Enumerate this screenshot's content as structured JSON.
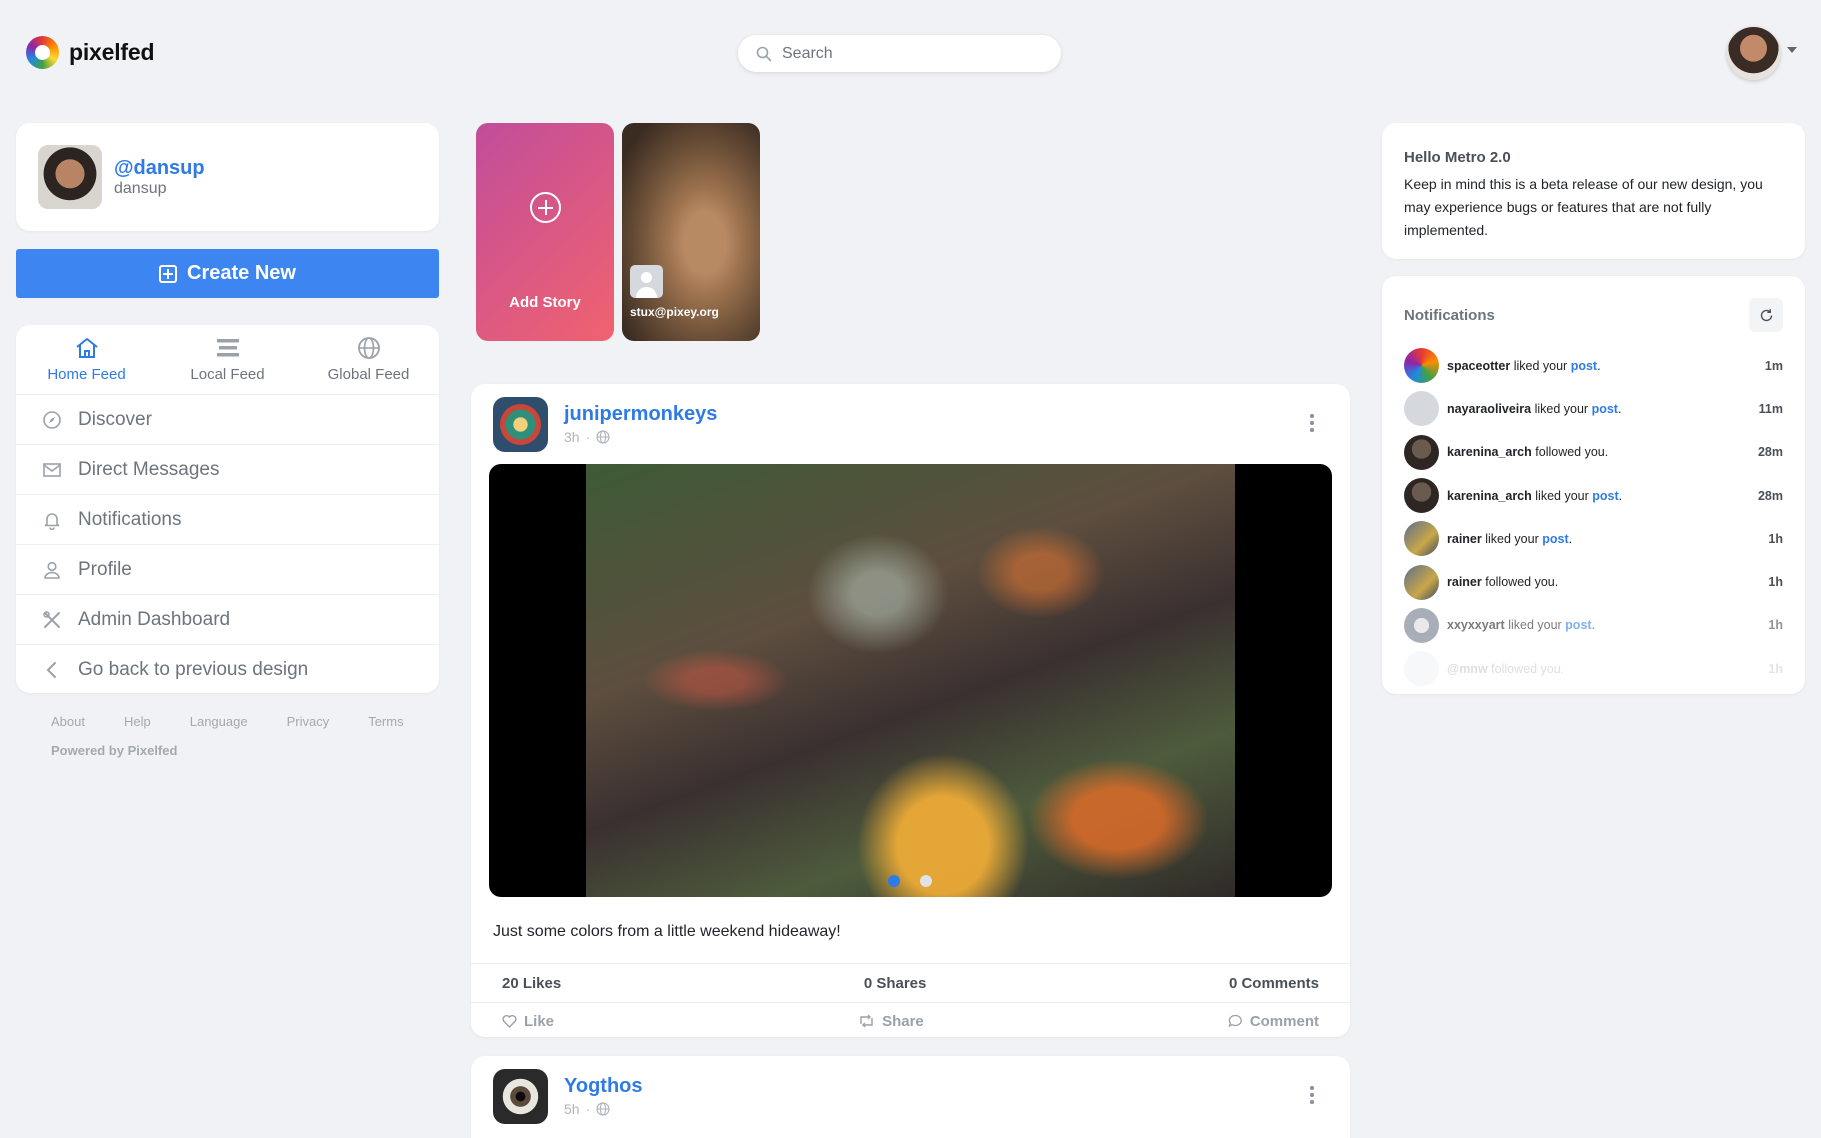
{
  "header": {
    "logo_text": "pixelfed",
    "search_placeholder": "Search"
  },
  "profile": {
    "handle": "@dansup",
    "name": "dansup"
  },
  "create_button": "Create New",
  "feed_tabs": [
    {
      "label": "Home Feed",
      "active": true,
      "icon": "home-icon"
    },
    {
      "label": "Local Feed",
      "active": false,
      "icon": "stack-icon"
    },
    {
      "label": "Global Feed",
      "active": false,
      "icon": "globe-icon"
    }
  ],
  "nav": [
    {
      "label": "Discover",
      "icon": "compass-icon"
    },
    {
      "label": "Direct Messages",
      "icon": "envelope-icon"
    },
    {
      "label": "Notifications",
      "icon": "bell-icon"
    },
    {
      "label": "Profile",
      "icon": "user-icon"
    },
    {
      "label": "Admin Dashboard",
      "icon": "tools-icon"
    },
    {
      "label": "Go back to previous design",
      "icon": "chevron-left-icon"
    }
  ],
  "footer": {
    "links": [
      "About",
      "Help",
      "Language",
      "Privacy",
      "Terms"
    ],
    "powered": "Powered by Pixelfed"
  },
  "stories": {
    "add_label": "Add Story",
    "items": [
      {
        "user": "stux@pixey.org"
      }
    ]
  },
  "posts": [
    {
      "username": "junipermonkeys",
      "time": "3h",
      "caption": "Just some colors from a little weekend hideaway!",
      "likes": "20 Likes",
      "shares": "0 Shares",
      "comments": "0 Comments",
      "actions": {
        "like": "Like",
        "share": "Share",
        "comment": "Comment"
      },
      "carousel_count": 2,
      "carousel_active": 1
    },
    {
      "username": "Yogthos",
      "time": "5h"
    }
  ],
  "hello": {
    "title": "Hello Metro 2.0",
    "text": "Keep in mind this is a beta release of our new design, you may experience bugs or features that are not fully implemented."
  },
  "notifications": {
    "title": "Notifications",
    "items": [
      {
        "user": "spaceotter",
        "action": "liked your",
        "link": "post",
        "time": "1m"
      },
      {
        "user": "nayaraoliveira",
        "action": "liked your",
        "link": "post",
        "time": "11m"
      },
      {
        "user": "karenina_arch",
        "action": "followed you.",
        "link": "",
        "time": "28m"
      },
      {
        "user": "karenina_arch",
        "action": "liked your",
        "link": "post",
        "time": "28m"
      },
      {
        "user": "rainer",
        "action": "liked your",
        "link": "post",
        "time": "1h"
      },
      {
        "user": "rainer",
        "action": "followed you.",
        "link": "",
        "time": "1h"
      },
      {
        "user": "xxyxxyart",
        "action": "liked your",
        "link": "post",
        "time": "1h"
      },
      {
        "user": "@mnw",
        "action": "followed you.",
        "link": "",
        "time": "1h"
      }
    ]
  },
  "colors": {
    "accent": "#3d85f0",
    "link": "#2f7be5",
    "background": "#f1f2f5"
  }
}
